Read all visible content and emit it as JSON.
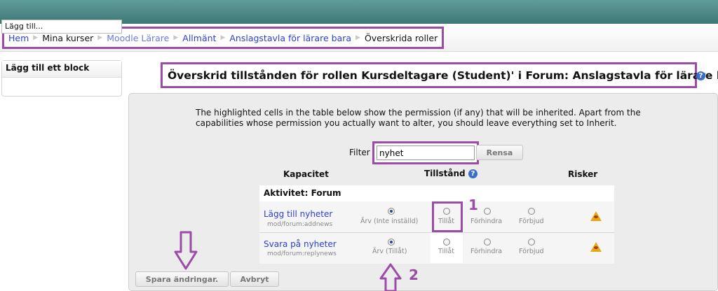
{
  "breadcrumb": {
    "home": "Hem",
    "my_courses": "Mina kurser",
    "course": "Moodle Lärare",
    "general": "Allmänt",
    "forum": "Anslagstavla för lärare bara",
    "current": "Överskrida roller"
  },
  "block": {
    "title": "Lägg till ett block",
    "select_value": "Lägg till..."
  },
  "page_title": "Överskrid tillstånden för rollen Kursdeltagare (Student)' i Forum: Anslagstavla för lärare bara",
  "intro": "The highlighted cells in the table below show the permission (if any) that will be inherited. Apart from the capabilities whose permission you actually want to alter, you should leave everything set to Inherit.",
  "filter": {
    "label": "Filter",
    "value": "nyhet",
    "clear_label": "Rensa"
  },
  "table": {
    "headers": {
      "capability": "Kapacitet",
      "permission": "Tillstånd",
      "risks": "Risker"
    },
    "group": "Aktivitet: Forum",
    "rows": [
      {
        "name": "Lägg till nyheter",
        "code": "mod/forum:addnews",
        "inherit": "Ärv (Inte inställd)",
        "allow": "Tillåt",
        "prevent": "Förhindra",
        "prohibit": "Förbjud",
        "selected": "inherit"
      },
      {
        "name": "Svara på nyheter",
        "code": "mod/forum:replynews",
        "inherit": "Ärv (Tillåt)",
        "allow": "Tillåt",
        "prevent": "Förhindra",
        "prohibit": "Förbjud",
        "selected": "inherit"
      }
    ]
  },
  "buttons": {
    "save": "Spara ändringar.",
    "cancel": "Avbryt"
  },
  "annotations": {
    "one": "1",
    "two": "2"
  },
  "colors": {
    "highlight": "#9b4ca6",
    "link": "#2a3fd0",
    "header_bar": "#4a8584"
  }
}
